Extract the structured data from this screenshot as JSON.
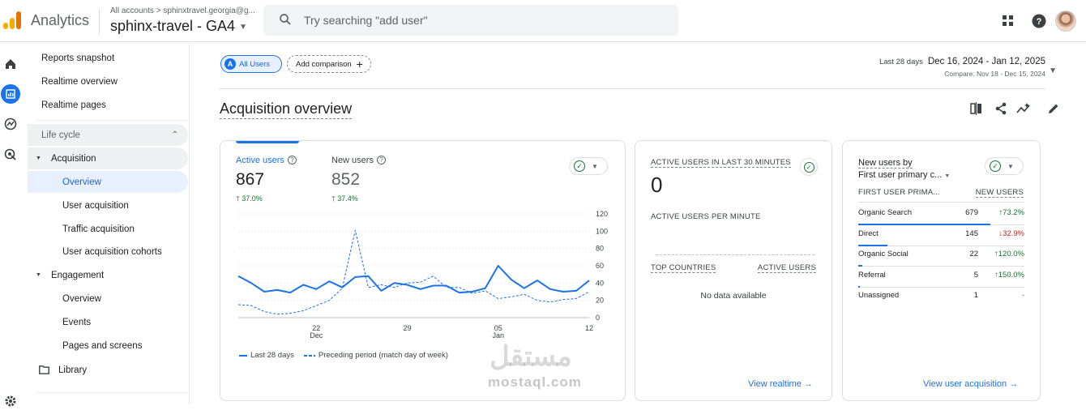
{
  "header": {
    "app_name": "Analytics",
    "breadcrumb": "All accounts > sphinxtravel.georgia@g...",
    "property": "sphinx-travel - GA4",
    "search_placeholder": "Try searching \"add user\""
  },
  "sidebar": {
    "items": [
      {
        "label": "Reports snapshot"
      },
      {
        "label": "Realtime overview"
      },
      {
        "label": "Realtime pages"
      }
    ],
    "lifecycle_label": "Life cycle",
    "acquisition_label": "Acquisition",
    "acquisition_items": [
      {
        "label": "Overview"
      },
      {
        "label": "User acquisition"
      },
      {
        "label": "Traffic acquisition"
      },
      {
        "label": "User acquisition cohorts"
      }
    ],
    "engagement_label": "Engagement",
    "engagement_items": [
      {
        "label": "Overview"
      },
      {
        "label": "Events"
      },
      {
        "label": "Pages and screens"
      }
    ],
    "library_label": "Library"
  },
  "filters": {
    "all_users": "All Users",
    "avatar_letter": "A",
    "add_comparison": "Add comparison",
    "range_label": "Last 28 days",
    "range_value": "Dec 16, 2024 - Jan 12, 2025",
    "compare": "Compare: Nov 18 - Dec 15, 2024"
  },
  "page_title": "Acquisition overview",
  "card_users": {
    "active_label": "Active users",
    "active_value": "867",
    "active_change": "37.0%",
    "new_label": "New users",
    "new_value": "852",
    "new_change": "37.4%",
    "legend_current": "Last 28 days",
    "legend_previous": "Preceding period (match day of week)"
  },
  "chart_data": {
    "type": "line",
    "x_tick_labels": [
      "22",
      "29",
      "05",
      "12"
    ],
    "x_tick_sublabels": [
      "Dec",
      "",
      "Jan",
      ""
    ],
    "y_tick_labels": [
      "120",
      "100",
      "80",
      "60",
      "40",
      "20",
      "0"
    ],
    "ylim": [
      0,
      120
    ],
    "series": [
      {
        "name": "Last 28 days",
        "style": "solid",
        "values": [
          48,
          40,
          30,
          32,
          29,
          38,
          33,
          42,
          35,
          47,
          48,
          31,
          40,
          38,
          33,
          37,
          37,
          29,
          30,
          34,
          60,
          44,
          34,
          43,
          33,
          30,
          31,
          43
        ]
      },
      {
        "name": "Preceding period (match day of week)",
        "style": "dashed",
        "values": [
          15,
          14,
          7,
          4,
          5,
          8,
          14,
          20,
          34,
          101,
          35,
          38,
          35,
          40,
          41,
          48,
          35,
          35,
          28,
          31,
          22,
          24,
          27,
          20,
          18,
          21,
          22,
          30
        ]
      }
    ]
  },
  "card_realtime": {
    "title": "ACTIVE USERS IN LAST 30 MINUTES",
    "value": "0",
    "per_minute_label": "ACTIVE USERS PER MINUTE",
    "col_countries": "TOP COUNTRIES",
    "col_users": "ACTIVE USERS",
    "empty": "No data available",
    "link": "View realtime"
  },
  "card_new_users": {
    "title_line1": "New users by",
    "title_line2": "First user primary c...",
    "col_dim": "FIRST USER PRIMA...",
    "col_val": "NEW USERS",
    "rows": [
      {
        "name": "Organic Search",
        "value": "679",
        "change": "73.2%",
        "dir": "up",
        "share": 0.96
      },
      {
        "name": "Direct",
        "value": "145",
        "change": "32.9%",
        "dir": "down",
        "share": 0.21
      },
      {
        "name": "Organic Social",
        "value": "22",
        "change": "120.0%",
        "dir": "up",
        "share": 0.03
      },
      {
        "name": "Referral",
        "value": "5",
        "change": "150.0%",
        "dir": "up",
        "share": 0.01
      },
      {
        "name": "Unassigned",
        "value": "1",
        "change": "-",
        "dir": "none",
        "share": 0.0
      }
    ],
    "link": "View user acquisition"
  },
  "watermark": {
    "ar": "مستقل",
    "en": "mostaql.com"
  },
  "colors": {
    "accent": "#1a73e8",
    "positive": "#137333",
    "negative": "#c5221f",
    "logo": [
      "#f9ab00",
      "#e37400",
      "#e37400"
    ]
  }
}
